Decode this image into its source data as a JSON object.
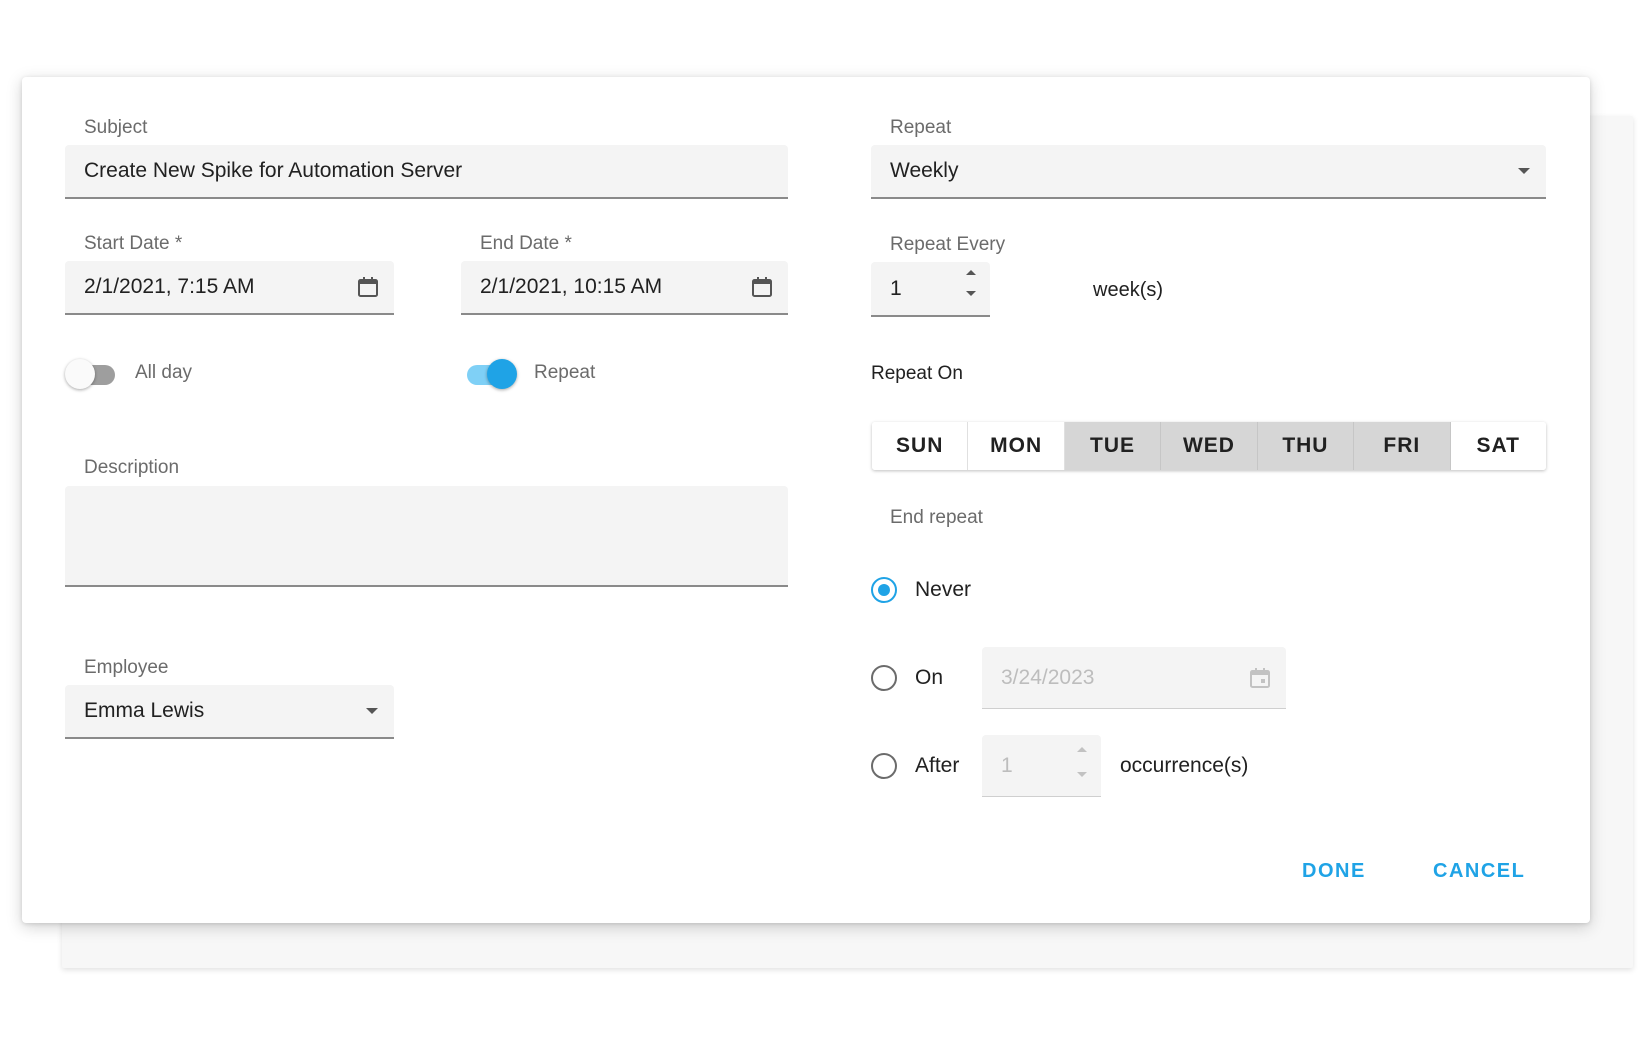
{
  "left": {
    "subject_label": "Subject",
    "subject_value": "Create New Spike for Automation Server",
    "start_label": "Start Date *",
    "start_value": "2/1/2021, 7:15 AM",
    "end_label": "End Date *",
    "end_value": "2/1/2021, 10:15 AM",
    "allday_label": "All day",
    "allday_on": false,
    "repeat_toggle_label": "Repeat",
    "repeat_toggle_on": true,
    "description_label": "Description",
    "description_value": "",
    "employee_label": "Employee",
    "employee_value": "Emma Lewis"
  },
  "right": {
    "repeat_label": "Repeat",
    "repeat_value": "Weekly",
    "repeat_every_label": "Repeat Every",
    "repeat_every_value": "1",
    "repeat_every_unit": "week(s)",
    "repeat_on_label": "Repeat On",
    "days": [
      {
        "label": "SUN",
        "selected": false
      },
      {
        "label": "MON",
        "selected": false
      },
      {
        "label": "TUE",
        "selected": true
      },
      {
        "label": "WED",
        "selected": true
      },
      {
        "label": "THU",
        "selected": true
      },
      {
        "label": "FRI",
        "selected": true
      },
      {
        "label": "SAT",
        "selected": false
      }
    ],
    "end_repeat_label": "End repeat",
    "never_label": "Never",
    "on_label": "On",
    "on_date_value": "3/24/2023",
    "after_label": "After",
    "after_count_value": "1",
    "occurrences_label": "occurrence(s)",
    "selected_end_option": "never"
  },
  "actions": {
    "done_label": "DONE",
    "cancel_label": "CANCEL"
  },
  "colors": {
    "accent": "#1fa3e6",
    "accent_track": "#7fd0f6",
    "toggle_off_track": "#9e9e9e",
    "field_bg": "#f4f4f4",
    "selected_day_bg": "#d6d6d6"
  },
  "icons": {
    "calendar": "calendar-icon",
    "dropdown": "chevron-down-icon",
    "spinner": "spinner-arrows-icon"
  }
}
